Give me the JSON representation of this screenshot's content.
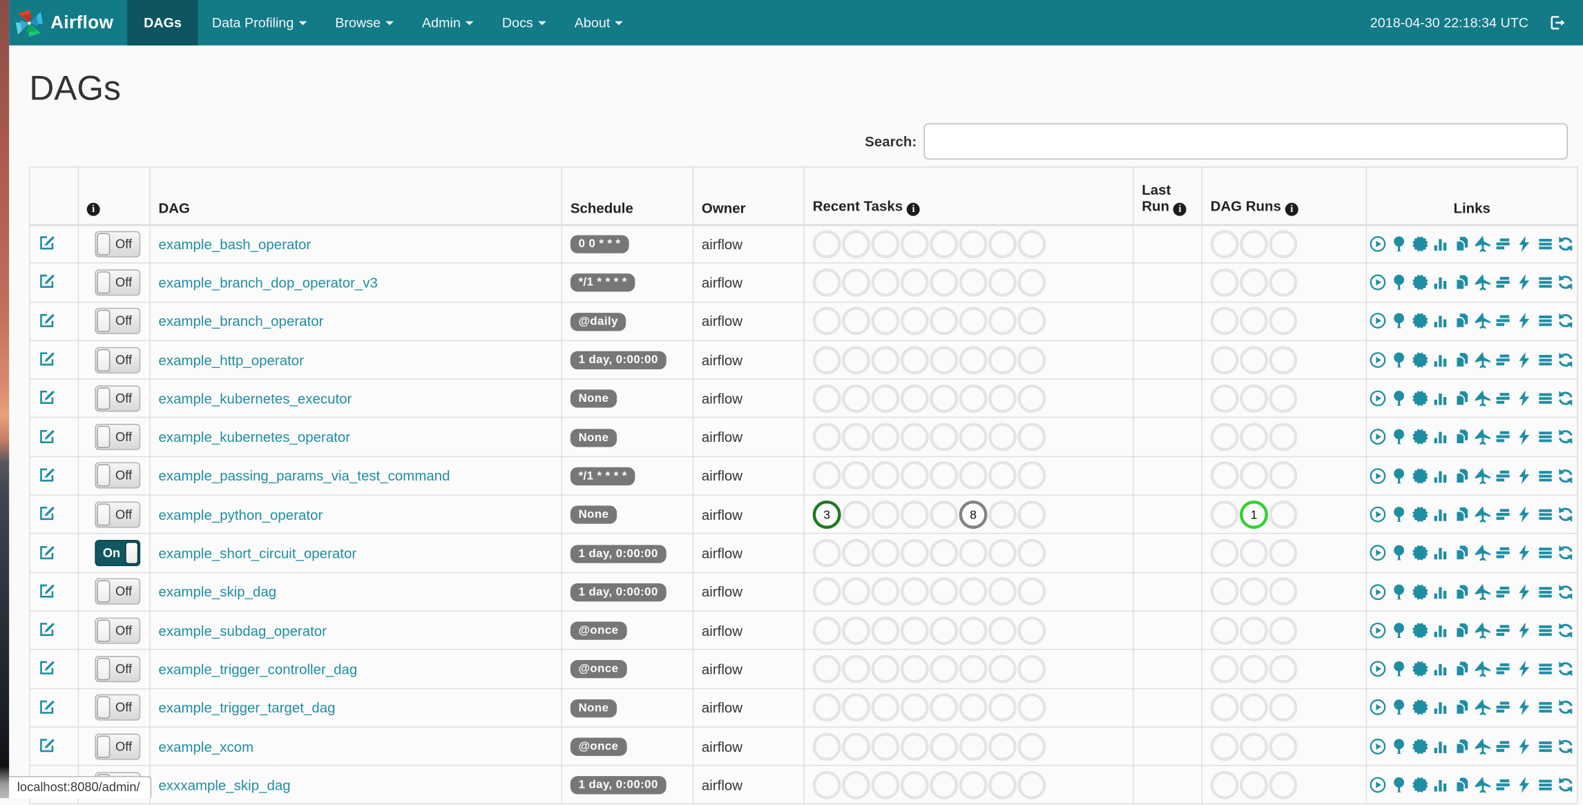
{
  "navbar": {
    "brand": "Airflow",
    "items": [
      {
        "label": "DAGs",
        "active": true,
        "caret": false
      },
      {
        "label": "Data Profiling",
        "active": false,
        "caret": true
      },
      {
        "label": "Browse",
        "active": false,
        "caret": true
      },
      {
        "label": "Admin",
        "active": false,
        "caret": true
      },
      {
        "label": "Docs",
        "active": false,
        "caret": true
      },
      {
        "label": "About",
        "active": false,
        "caret": true
      }
    ],
    "clock": "2018-04-30 22:18:34 UTC",
    "logout_icon": "logout-icon"
  },
  "page": {
    "title": "DAGs"
  },
  "search": {
    "label": "Search:",
    "value": ""
  },
  "table": {
    "headers": {
      "info_icon": "info-icon",
      "dag": "DAG",
      "schedule": "Schedule",
      "owner": "Owner",
      "recent_tasks": "Recent Tasks",
      "last_run": "Last Run",
      "dag_runs": "DAG Runs",
      "links": "Links"
    },
    "recent_task_circle_count": 8,
    "dag_run_circle_count": 3,
    "links_icons": [
      "trigger-play-circle-icon",
      "tree-view-icon",
      "graph-view-sunburst-icon",
      "task-duration-chart-icon",
      "task-tries-copy-icon",
      "landing-times-plane-icon",
      "gantt-icon",
      "code-view-bolt-icon",
      "logs-list-icon",
      "refresh-icon"
    ],
    "rows": [
      {
        "toggle": "Off",
        "dag_id": "example_bash_operator",
        "schedule": "0 0 * * *",
        "owner": "airflow",
        "last_run": "",
        "recent_task_overrides": [],
        "dag_run_overrides": []
      },
      {
        "toggle": "Off",
        "dag_id": "example_branch_dop_operator_v3",
        "schedule": "*/1 * * * *",
        "owner": "airflow",
        "last_run": "",
        "recent_task_overrides": [],
        "dag_run_overrides": []
      },
      {
        "toggle": "Off",
        "dag_id": "example_branch_operator",
        "schedule": "@daily",
        "owner": "airflow",
        "last_run": "",
        "recent_task_overrides": [],
        "dag_run_overrides": []
      },
      {
        "toggle": "Off",
        "dag_id": "example_http_operator",
        "schedule": "1 day, 0:00:00",
        "owner": "airflow",
        "last_run": "",
        "recent_task_overrides": [],
        "dag_run_overrides": []
      },
      {
        "toggle": "Off",
        "dag_id": "example_kubernetes_executor",
        "schedule": "None",
        "owner": "airflow",
        "last_run": "",
        "recent_task_overrides": [],
        "dag_run_overrides": []
      },
      {
        "toggle": "Off",
        "dag_id": "example_kubernetes_operator",
        "schedule": "None",
        "owner": "airflow",
        "last_run": "",
        "recent_task_overrides": [],
        "dag_run_overrides": []
      },
      {
        "toggle": "Off",
        "dag_id": "example_passing_params_via_test_command",
        "schedule": "*/1 * * * *",
        "owner": "airflow",
        "last_run": "",
        "recent_task_overrides": [],
        "dag_run_overrides": []
      },
      {
        "toggle": "Off",
        "dag_id": "example_python_operator",
        "schedule": "None",
        "owner": "airflow",
        "last_run": "",
        "recent_task_overrides": [
          {
            "index": 0,
            "state": "success",
            "count": "3"
          },
          {
            "index": 5,
            "state": "queued",
            "count": "8"
          }
        ],
        "dag_run_overrides": [
          {
            "index": 1,
            "state": "running",
            "count": "1"
          }
        ]
      },
      {
        "toggle": "On",
        "dag_id": "example_short_circuit_operator",
        "schedule": "1 day, 0:00:00",
        "owner": "airflow",
        "last_run": "",
        "recent_task_overrides": [],
        "dag_run_overrides": []
      },
      {
        "toggle": "Off",
        "dag_id": "example_skip_dag",
        "schedule": "1 day, 0:00:00",
        "owner": "airflow",
        "last_run": "",
        "recent_task_overrides": [],
        "dag_run_overrides": []
      },
      {
        "toggle": "Off",
        "dag_id": "example_subdag_operator",
        "schedule": "@once",
        "owner": "airflow",
        "last_run": "",
        "recent_task_overrides": [],
        "dag_run_overrides": []
      },
      {
        "toggle": "Off",
        "dag_id": "example_trigger_controller_dag",
        "schedule": "@once",
        "owner": "airflow",
        "last_run": "",
        "recent_task_overrides": [],
        "dag_run_overrides": []
      },
      {
        "toggle": "Off",
        "dag_id": "example_trigger_target_dag",
        "schedule": "None",
        "owner": "airflow",
        "last_run": "",
        "recent_task_overrides": [],
        "dag_run_overrides": []
      },
      {
        "toggle": "Off",
        "dag_id": "example_xcom",
        "schedule": "@once",
        "owner": "airflow",
        "last_run": "",
        "recent_task_overrides": [],
        "dag_run_overrides": []
      },
      {
        "toggle": "Off",
        "dag_id": "exxxample_skip_dag",
        "schedule": "1 day, 0:00:00",
        "owner": "airflow",
        "last_run": "",
        "recent_task_overrides": [],
        "dag_run_overrides": []
      }
    ]
  },
  "status_bar": {
    "url": "localhost:8080/admin/"
  },
  "colors": {
    "navbar": "#137a87",
    "navbar_active_tab": "#0d5560",
    "link_teal": "#1f8ea3",
    "schedule_badge": "#777777",
    "toggle_on": "#115762",
    "task_states": {
      "none": "#e4e4e4",
      "success": "#1e7a1e",
      "queued": "#828282",
      "running": "#2fd32f"
    }
  }
}
